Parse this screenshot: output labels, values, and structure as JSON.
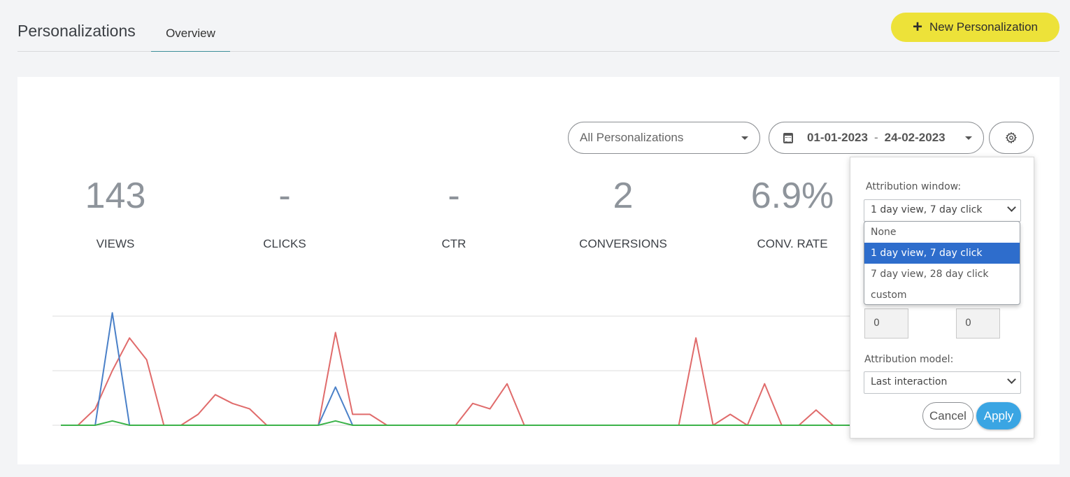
{
  "header": {
    "title": "Personalizations",
    "tab_overview": "Overview",
    "new_button_label": "New Personalization"
  },
  "filters": {
    "personalization_select": "All Personalizations",
    "date_start": "01-01-2023",
    "date_separator": "-",
    "date_end": "24-02-2023"
  },
  "metrics": [
    {
      "value": "143",
      "label": "VIEWS"
    },
    {
      "value": "-",
      "label": "CLICKS"
    },
    {
      "value": "-",
      "label": "CTR"
    },
    {
      "value": "2",
      "label": "CONVERSIONS"
    },
    {
      "value": "6.9%",
      "label": "CONV. RATE"
    }
  ],
  "settings_popover": {
    "attribution_window_label": "Attribution window:",
    "attribution_window_value": "1 day view, 7 day click",
    "attribution_window_options": [
      "None",
      "1 day view, 7 day click",
      "7 day view, 28 day click",
      "custom"
    ],
    "selected_option_index": 1,
    "custom_view_days": "0",
    "custom_click_days": "0",
    "attribution_model_label": "Attribution model:",
    "attribution_model_value": "Last interaction",
    "cancel_label": "Cancel",
    "apply_label": "Apply"
  },
  "colors": {
    "accent_yellow": "#ede239",
    "apply_blue": "#3aa5e3",
    "selected_option_blue": "#2e6dcc",
    "series_views": "#e06b6b",
    "series_clicks": "#4a80c8",
    "series_conversions": "#3cb34a"
  },
  "chart_data": {
    "type": "line",
    "ylim": [
      0,
      10
    ],
    "grid": true,
    "series": [
      {
        "color": "#e06b6b",
        "values": [
          0,
          0,
          1.5,
          5,
          8,
          6,
          0,
          0,
          1,
          2.8,
          2,
          1.5,
          0,
          0,
          0,
          0,
          8.5,
          1,
          1,
          0,
          0,
          0,
          0,
          0,
          2,
          1.5,
          3.8,
          0,
          0,
          0,
          0,
          0,
          0,
          0,
          0,
          0,
          0,
          8,
          0,
          1,
          0,
          3.8,
          0,
          0,
          1.4,
          0,
          0
        ]
      },
      {
        "color": "#4a80c8",
        "values": [
          0,
          0,
          0,
          10.3,
          0,
          0,
          0,
          0,
          0,
          0,
          0,
          0,
          0,
          0,
          0,
          0,
          3.5,
          0,
          0,
          0,
          0,
          0,
          0,
          0,
          0,
          0,
          0,
          0,
          0,
          0,
          0,
          0,
          0,
          0,
          0,
          0,
          0,
          0,
          0,
          0,
          0,
          0,
          0,
          0,
          0,
          0,
          0
        ]
      },
      {
        "color": "#3cb34a",
        "values": [
          0,
          0,
          0,
          0.4,
          0,
          0,
          0,
          0,
          0,
          0,
          0,
          0,
          0,
          0,
          0,
          0,
          0.4,
          0,
          0,
          0,
          0,
          0,
          0,
          0,
          0,
          0,
          0,
          0,
          0,
          0,
          0,
          0,
          0,
          0,
          0,
          0,
          0,
          0,
          0,
          0,
          0,
          0,
          0,
          0,
          0,
          0,
          0
        ]
      }
    ]
  }
}
